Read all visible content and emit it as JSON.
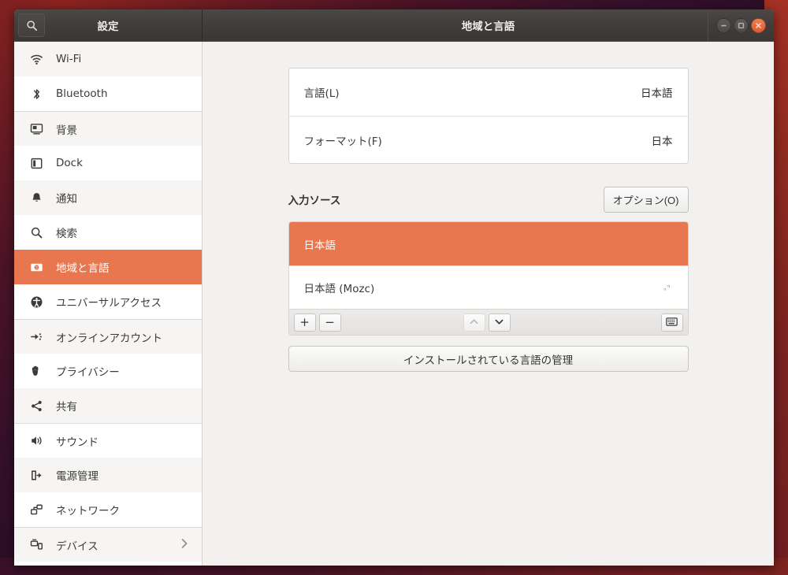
{
  "window": {
    "sidebar_title": "設定",
    "content_title": "地域と言語",
    "search_icon": "search-icon",
    "buttons": {
      "minimize": "minimize-button",
      "maximize": "maximize-button",
      "close": "close-button"
    }
  },
  "colors": {
    "accent_orange": "#e8764f",
    "close_button": "#e05e34",
    "titlebar": "#403d3b",
    "panel_bg": "#f2f1f0",
    "sidebar_alt_row": "#f6f5f4"
  },
  "sidebar": {
    "items": [
      {
        "label": "Wi-Fi",
        "icon": "wifi-icon",
        "active": false,
        "group_start": false
      },
      {
        "label": "Bluetooth",
        "icon": "bluetooth-icon",
        "active": false,
        "group_start": false
      },
      {
        "label": "背景",
        "icon": "background-icon",
        "active": false,
        "group_start": true
      },
      {
        "label": "Dock",
        "icon": "dock-icon",
        "active": false,
        "group_start": false
      },
      {
        "label": "通知",
        "icon": "notifications-bell-icon",
        "active": false,
        "group_start": false
      },
      {
        "label": "検索",
        "icon": "search-icon",
        "active": false,
        "group_start": false
      },
      {
        "label": "地域と言語",
        "icon": "region-language-icon",
        "active": true,
        "group_start": false
      },
      {
        "label": "ユニバーサルアクセス",
        "icon": "universal-access-icon",
        "active": false,
        "group_start": false
      },
      {
        "label": "オンラインアカウント",
        "icon": "online-accounts-icon",
        "active": false,
        "group_start": true
      },
      {
        "label": "プライバシー",
        "icon": "privacy-hand-icon",
        "active": false,
        "group_start": false
      },
      {
        "label": "共有",
        "icon": "sharing-icon",
        "active": false,
        "group_start": false
      },
      {
        "label": "サウンド",
        "icon": "sound-speaker-icon",
        "active": false,
        "group_start": true
      },
      {
        "label": "電源管理",
        "icon": "power-plug-icon",
        "active": false,
        "group_start": false
      },
      {
        "label": "ネットワーク",
        "icon": "network-icon",
        "active": false,
        "group_start": false
      },
      {
        "label": "デバイス",
        "icon": "devices-icon",
        "active": false,
        "group_start": true,
        "has_chevron": true
      }
    ]
  },
  "main": {
    "language_rows": [
      {
        "label": "言語(L)",
        "value": "日本語"
      },
      {
        "label": "フォーマット(F)",
        "value": "日本"
      }
    ],
    "input_sources": {
      "section_title": "入力ソース",
      "options_button": "オプション(O)",
      "items": [
        {
          "label": "日本語",
          "selected": true,
          "has_gear": false
        },
        {
          "label": "日本語 (Mozc)",
          "selected": false,
          "has_gear": true,
          "gear_icon": "preferences-gear-icon"
        }
      ],
      "toolbar": {
        "add": "+",
        "remove": "−",
        "move_up_icon": "chevron-up-icon",
        "move_down_icon": "chevron-down-icon",
        "keyboard_icon": "keyboard-icon",
        "move_up_disabled": true
      }
    },
    "manage_button": "インストールされている言語の管理"
  }
}
